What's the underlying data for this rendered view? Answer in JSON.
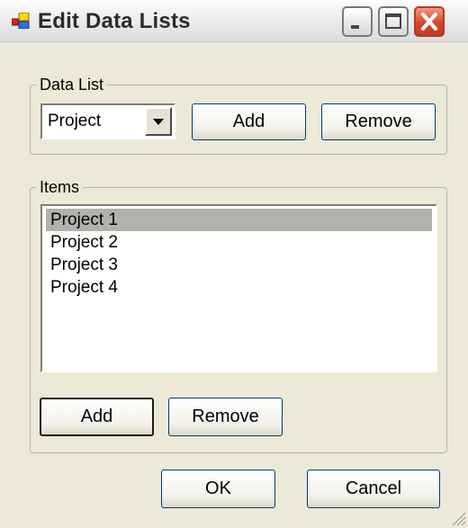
{
  "window": {
    "title": "Edit Data Lists"
  },
  "data_list_group": {
    "legend": "Data List",
    "combo_value": "Project",
    "add_label": "Add",
    "remove_label": "Remove"
  },
  "items_group": {
    "legend": "Items",
    "items": [
      "Project 1",
      "Project 2",
      "Project 3",
      "Project 4"
    ],
    "selected_index": 0,
    "add_label": "Add",
    "remove_label": "Remove"
  },
  "footer": {
    "ok_label": "OK",
    "cancel_label": "Cancel"
  },
  "colors": {
    "face": "#ece9d8",
    "selection": "#b3b1ac",
    "close_button": "#d6462a"
  }
}
